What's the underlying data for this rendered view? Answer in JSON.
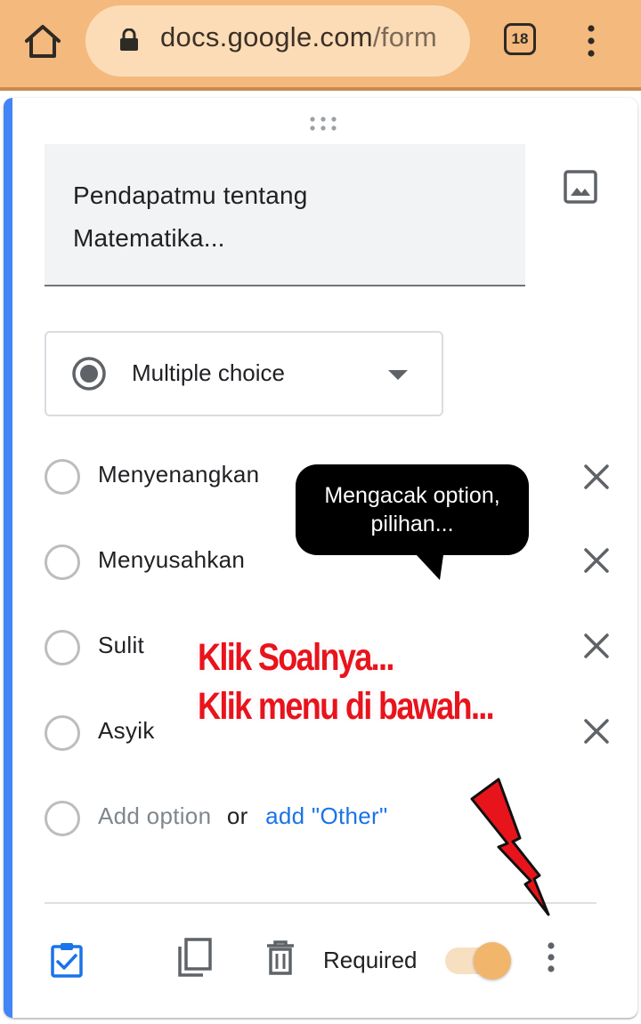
{
  "browser": {
    "url_main": "docs.google.com",
    "url_path": "/form",
    "tab_count": "18"
  },
  "question": {
    "title_line1": "Pendapatmu tentang",
    "title_line2": "Matematika..."
  },
  "type_select": {
    "selected": "Multiple choice"
  },
  "options": [
    {
      "label": "Menyenangkan"
    },
    {
      "label": "Menyusahkan"
    },
    {
      "label": "Sulit"
    },
    {
      "label": "Asyik"
    }
  ],
  "add_row": {
    "add_option": "Add option",
    "or": "or",
    "add_other": "add \"Other\""
  },
  "footer": {
    "required_label": "Required",
    "required_on": true
  },
  "annotations": {
    "bubble_line1": "Mengacak option,",
    "bubble_line2": "pilihan...",
    "instruction_line1": "Klik Soalnya...",
    "instruction_line2": "Klik menu di bawah..."
  },
  "colors": {
    "browser_bar": "#f4b97c",
    "accent": "#4285f4",
    "link": "#1a73e8",
    "toggle": "#f1b56c",
    "instruction": "#e8141c"
  }
}
